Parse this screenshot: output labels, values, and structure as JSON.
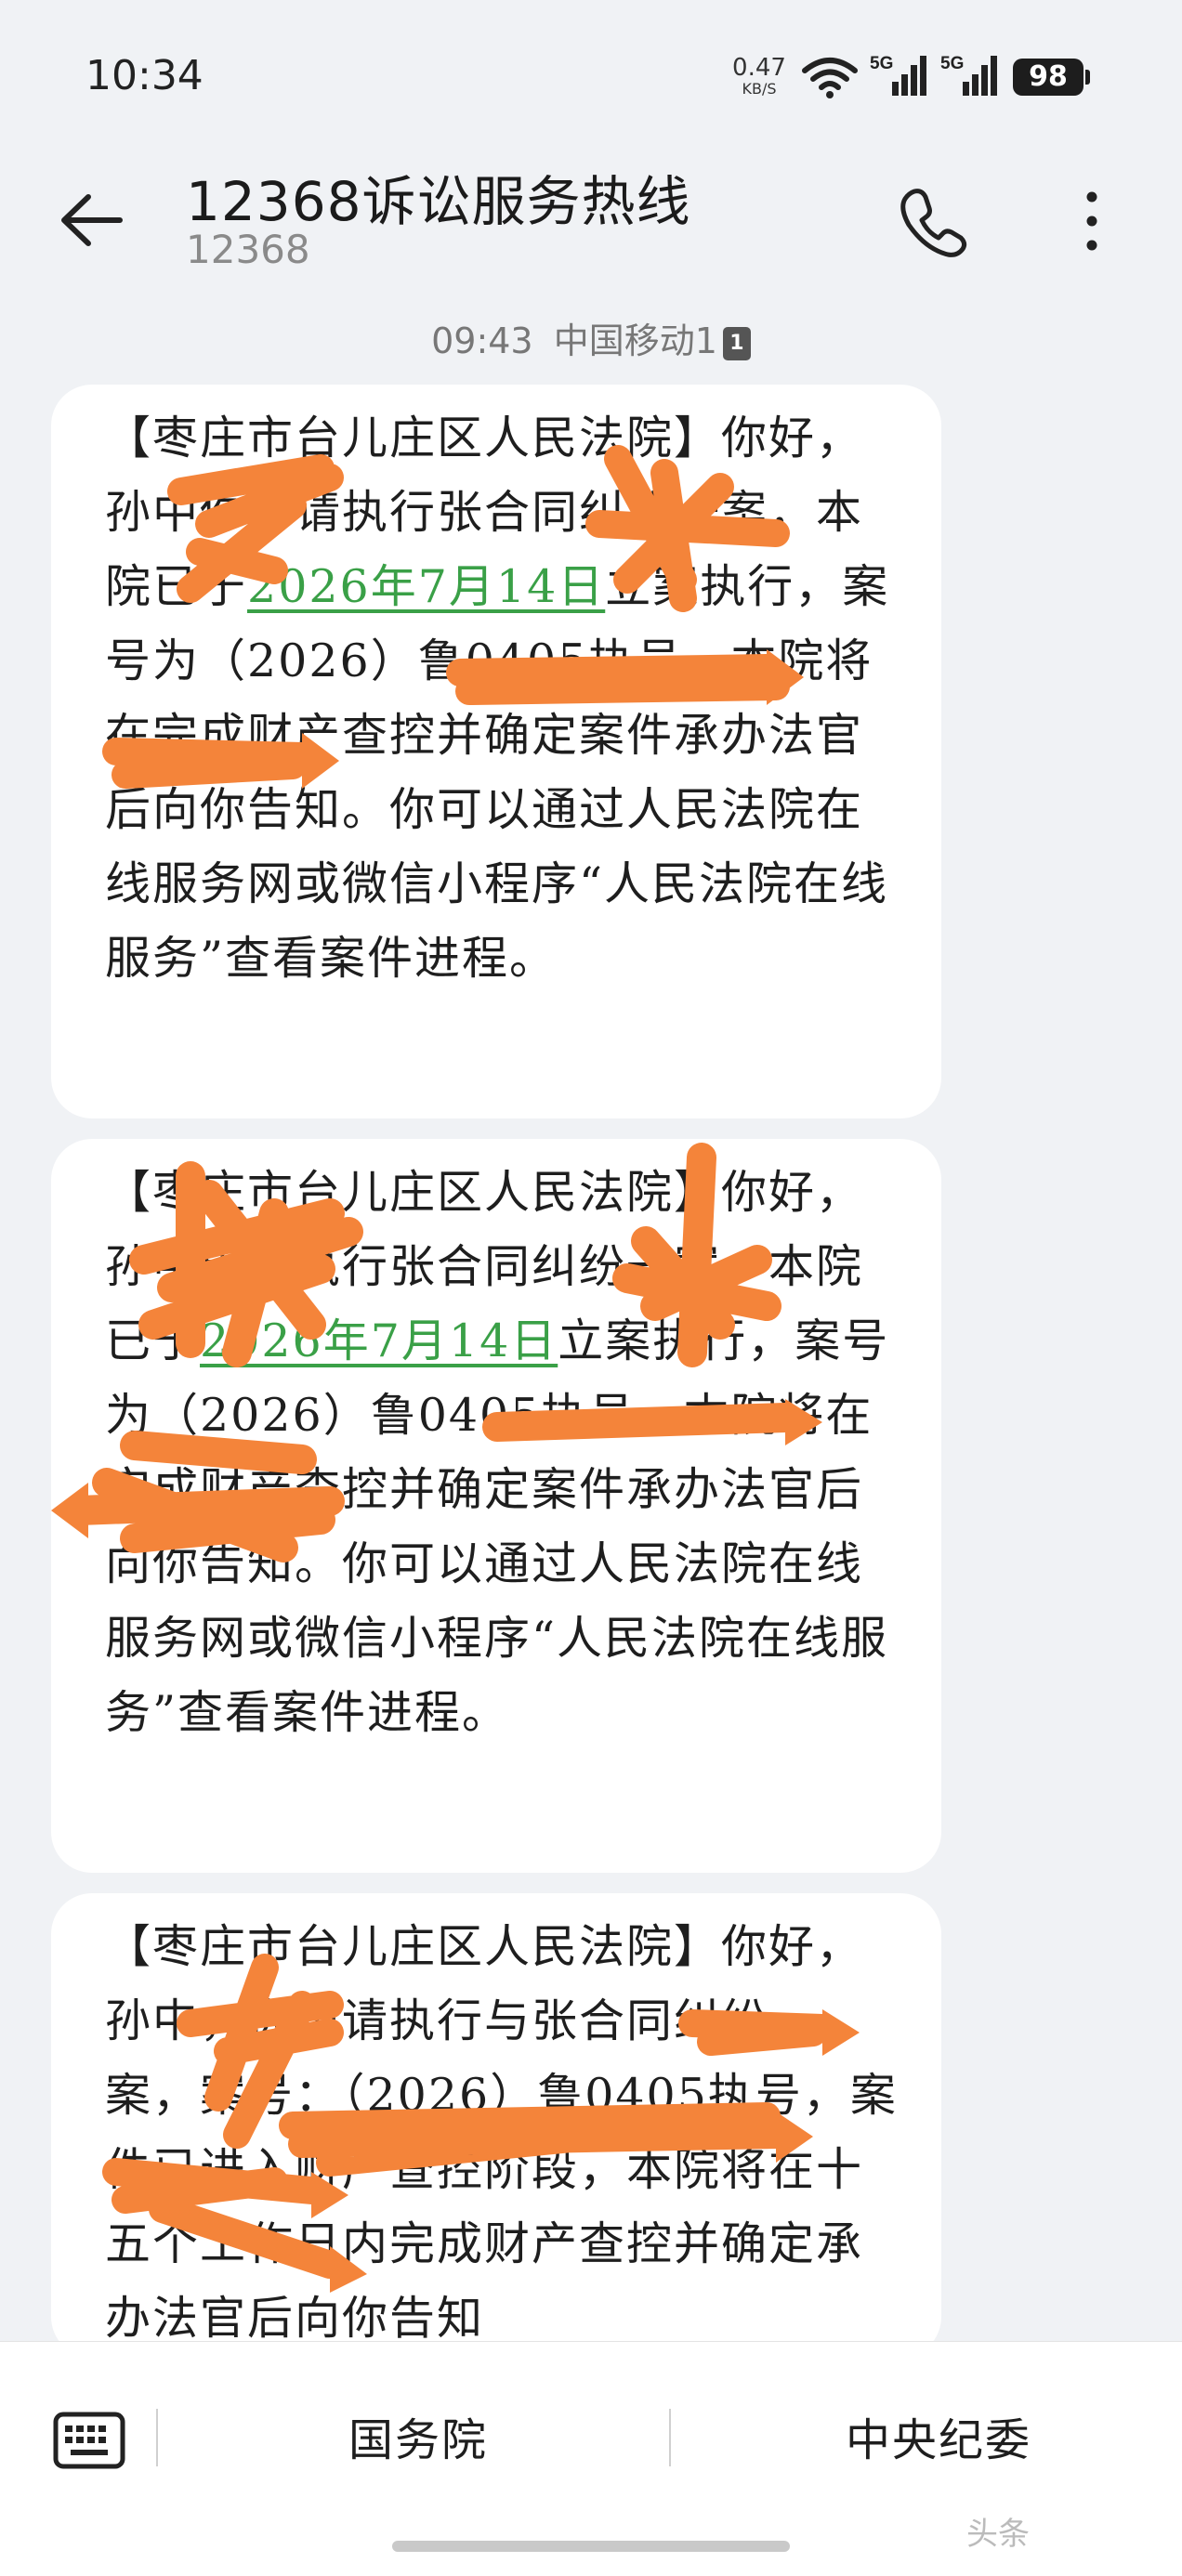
{
  "status_bar": {
    "time": "10:34",
    "net_speed_value": "0.47",
    "net_speed_unit": "KB/S",
    "signal_1_label": "5G",
    "signal_2_label": "5G",
    "battery": "98"
  },
  "header": {
    "title": "12368诉讼服务热线",
    "number": "12368",
    "back_icon": "back-arrow-icon",
    "call_icon": "phone-icon",
    "more_icon": "more-vertical-icon"
  },
  "message_meta": {
    "time": "09:43",
    "carrier": "中国移动1",
    "sim": "1"
  },
  "messages": [
    {
      "p1": "【枣庄市台儿庄区人民法院】你好，孙中",
      "p2": "你申请执行张",
      "p3": "合同纠纷一案，本院已于",
      "date": "2026年7月14日",
      "p4": "立案执行，案号为（2026）鲁0405执",
      "p5": "号，本院将在完成财产查控并确定案件承办法官后向你告知。你可以通过人民法院在线服务网或微信小程序“人民法院在线服务”查看案件进程。"
    },
    {
      "p1": "【枣庄市台儿庄区人民法院】你好，孙中",
      "p2": "申请执行张",
      "p3": "合同纠纷一案，本院已于",
      "date": "2026年7月14日",
      "p4": "立案执行，案号为（2026）鲁0405执",
      "p5": "号，本院将在完成财产查控并确定案件承办法官后向你告知。你可以通过人民法院在线服务网或微信小程序“人民法院在线服务”查看案件进程。"
    },
    {
      "text": "【枣庄市台儿庄区人民法院】你好，孙中，你申请执行与张合同纠纷一案，案号：（2026）鲁0405执号，案件已进入财产查控阶段，本院将在十五个工作日内完成财产查控并确定承办法官后向你告知"
    }
  ],
  "bottom_bar": {
    "keyboard_icon": "keyboard-icon",
    "reply_1": "国务院",
    "reply_2": "中央纪委"
  },
  "watermark": "头条"
}
